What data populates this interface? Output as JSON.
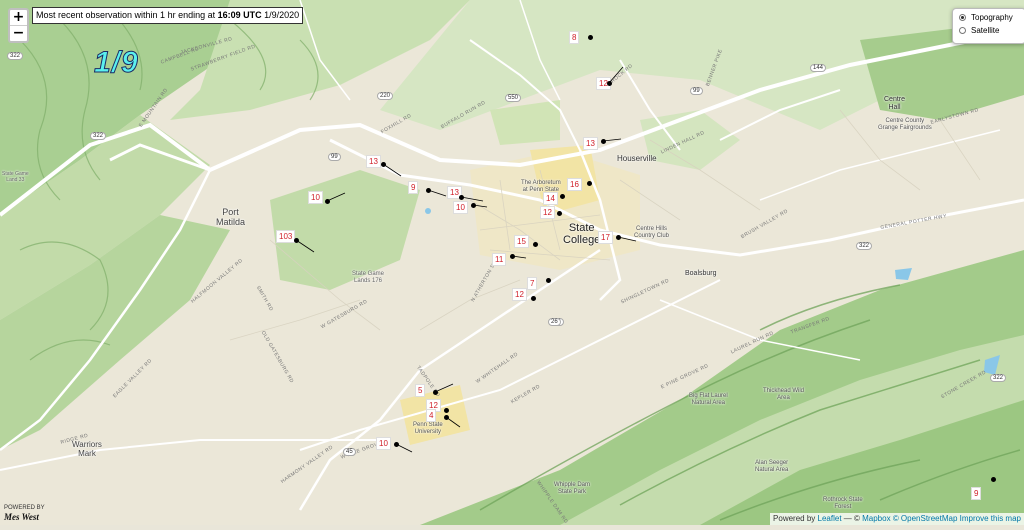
{
  "map": {
    "zoom_in": "+",
    "zoom_out": "−",
    "obs_prefix": "Most recent observation within 1 hr ending at ",
    "obs_time": "16:09 UTC",
    "obs_date": "1/9/2020",
    "big_date": "1/9"
  },
  "layers": {
    "topography": "Topography",
    "satellite": "Satellite",
    "selected": "Topography"
  },
  "attribution": {
    "powered_by": "Powered by ",
    "leaflet": "Leaflet",
    "sep": " — © ",
    "mapbox": "Mapbox",
    "osm": "© OpenStreetMap",
    "improve": "Improve this map"
  },
  "powered_logo": {
    "powered": "POWERED BY",
    "brand": "Mes West"
  },
  "colors": {
    "forest": "#a6cc8d",
    "ridge": "#8ab873",
    "land": "#ebe7d8",
    "road": "#ffffff",
    "urban": "#f2e6a6",
    "water": "#8ac7e8",
    "temp_text": "#d0202a"
  },
  "places": [
    {
      "name": "Port",
      "sub": "Matilda"
    },
    {
      "name": "State",
      "sub": "College"
    },
    {
      "name": "Houserville",
      "sub": ""
    },
    {
      "name": "Boalsburg",
      "sub": ""
    },
    {
      "name": "Centre",
      "sub": "Hall"
    },
    {
      "name": "Warriors",
      "sub": "Mark"
    },
    {
      "name": "Centre Hills",
      "sub": "Country Club"
    },
    {
      "name": "The Arboretum",
      "sub": "at Penn State"
    },
    {
      "name": "Penn State",
      "sub": "University"
    },
    {
      "name": "State Game",
      "sub": "Lands 176"
    },
    {
      "name": "State Game",
      "sub": "Land 33"
    },
    {
      "name": "Big Flat Laurel",
      "sub": "Natural Area"
    },
    {
      "name": "Thickhead Wild",
      "sub": "Area"
    },
    {
      "name": "Alan Seeger",
      "sub": "Natural Area"
    },
    {
      "name": "Whipple Dam",
      "sub": "State Park"
    },
    {
      "name": "Rothrock State",
      "sub": "Forest"
    },
    {
      "name": "Centre County",
      "sub": "Grange Fairgrounds"
    }
  ],
  "roads": [
    "E MOUNTAIN RD",
    "EAGLE VALLEY RD",
    "BUFFALO RUN RD",
    "W WHITEHALL RD",
    "W PINE GROVE RD",
    "SHINGLETOWN RD",
    "HALFMOON VALLEY RD",
    "W GATESBURG RD",
    "ROCK RD",
    "E PINE GROVE RD",
    "CAMPBELL RD",
    "BRUSH VALLEY RD",
    "GENERAL POTTER HWY",
    "LINDEN HALL RD",
    "EARLYSTOWN RD",
    "TRANSFER RD",
    "LAUREL RUN RD",
    "STONE CREEK RD",
    "KEPLER RD",
    "HARMONY VALLEY RD",
    "RIDGE RD",
    "STRAWBERRY FIELD RD",
    "SMITH RD",
    "OLD GATESBURG RD",
    "N ATHERTON ST",
    "FOXHILL RD",
    "BENNER PIKE",
    "JACKSONVILLE RD",
    "TADPOLE RD",
    "WHIPPLE DAM RD"
  ],
  "shields": [
    "322",
    "550",
    "99",
    "220",
    "26",
    "45",
    "144",
    "322",
    "322",
    "26",
    "45",
    "99",
    "322"
  ],
  "stations": [
    {
      "temp": "8"
    },
    {
      "temp": "12"
    },
    {
      "temp": "13"
    },
    {
      "temp": "13"
    },
    {
      "temp": "10"
    },
    {
      "temp": "9"
    },
    {
      "temp": "13"
    },
    {
      "temp": "10"
    },
    {
      "temp": "16"
    },
    {
      "temp": "14"
    },
    {
      "temp": "12"
    },
    {
      "temp": "103"
    },
    {
      "temp": "15"
    },
    {
      "temp": "17"
    },
    {
      "temp": "11"
    },
    {
      "temp": "7"
    },
    {
      "temp": "12"
    },
    {
      "temp": "5"
    },
    {
      "temp": "12"
    },
    {
      "temp": "4"
    },
    {
      "temp": "10"
    },
    {
      "temp": "9"
    }
  ]
}
